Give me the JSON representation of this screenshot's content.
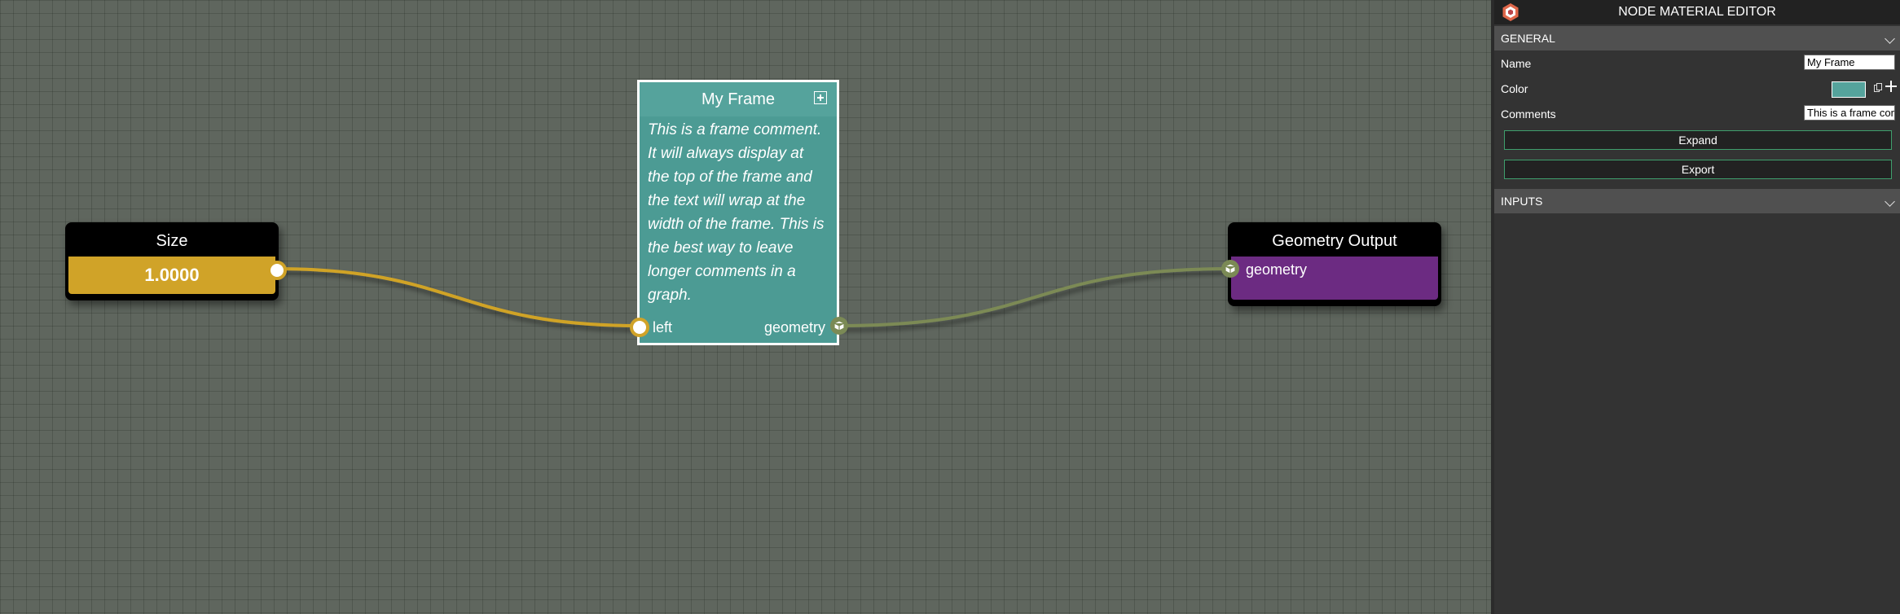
{
  "canvas": {
    "nodes": {
      "size": {
        "title": "Size",
        "value": "1.0000"
      },
      "geometry_output": {
        "title": "Geometry Output",
        "port_label": "geometry"
      }
    },
    "frame": {
      "title": "My Frame",
      "comment": "This is a frame comment. It will always display at the top of the frame and the text will wrap at the width of the frame. This is the best way to leave longer comments in a graph.",
      "input_label": "left",
      "output_label": "geometry"
    },
    "colors": {
      "size_node": "#d0a328",
      "geometry_output_node": "#6c2b82",
      "frame": "#4c9b94",
      "link_float": "#d0a328",
      "link_geometry": "#7b8a55"
    }
  },
  "panel": {
    "title": "NODE MATERIAL EDITOR",
    "logo_icon": "babylon-logo-icon",
    "sections": {
      "general": {
        "label": "GENERAL"
      },
      "inputs": {
        "label": "INPUTS"
      }
    },
    "properties": {
      "name": {
        "label": "Name",
        "value": "My Frame"
      },
      "color": {
        "label": "Color",
        "value": "#55a39c"
      },
      "comments": {
        "label": "Comments",
        "value": "This is a frame comment. It will always display at the top of the frame and the text will wrap at the width of the frame. This is the best way to leave longer comments in a graph."
      }
    },
    "buttons": {
      "expand": "Expand",
      "export": "Export"
    }
  }
}
